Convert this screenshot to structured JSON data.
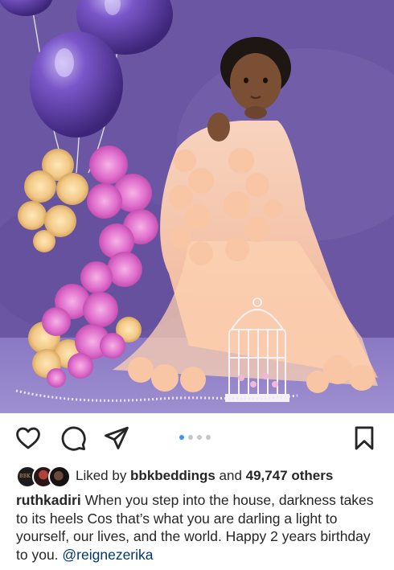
{
  "post": {
    "carousel": {
      "count": 4,
      "active_index": 0
    }
  },
  "icons": {
    "like": "heart-outline-icon",
    "comment": "speech-bubble-icon",
    "share": "paper-plane-icon",
    "save": "bookmark-icon"
  },
  "likes": {
    "prefix": "Liked by ",
    "user": "bbkbeddings",
    "connector": " and ",
    "count": "49,747 others"
  },
  "caption": {
    "username": "ruthkadiri",
    "text": " When you step into the house, darkness takes to its heels Cos that’s what you are darling a light to yourself, our lives, and the world.  Happy 2 years birthday to you. ",
    "mention": "@reignezerika"
  },
  "colors": {
    "accent": "#3897f0",
    "mention": "#00376b",
    "text": "#262626",
    "dot_inactive": "#c7c7c7"
  }
}
